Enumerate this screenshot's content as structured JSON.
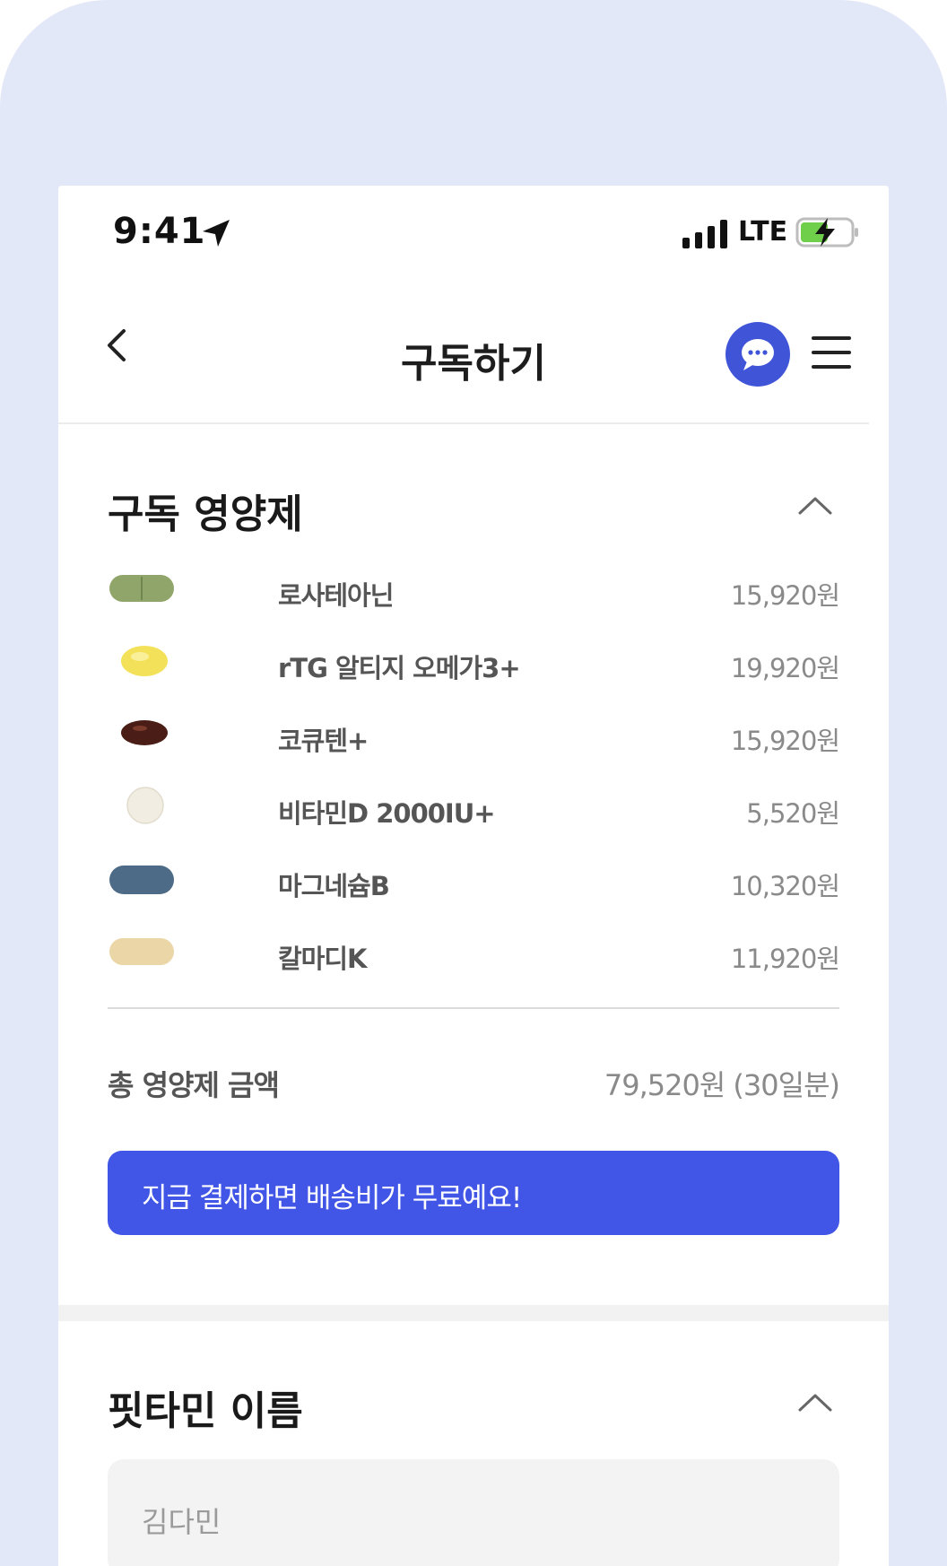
{
  "status_bar": {
    "time": "9:41",
    "network": "LTE"
  },
  "header": {
    "title": "구독하기",
    "chat_icon": "chat-bubble-icon",
    "menu_icon": "hamburger-menu-icon"
  },
  "subscription": {
    "title": "구독 영양제",
    "items": [
      {
        "name": "로사테아닌",
        "price": "15,920원",
        "pill_color": "#8fa56a"
      },
      {
        "name": "rTG 알티지 오메가3+",
        "price": "19,920원",
        "pill_color": "#f4e15a"
      },
      {
        "name": "코큐텐+",
        "price": "15,920원",
        "pill_color": "#4a1e16"
      },
      {
        "name": "비타민D 2000IU+",
        "price": "5,520원",
        "pill_color": "#f1ede2"
      },
      {
        "name": "마그네슘B",
        "price": "10,320원",
        "pill_color": "#4d6a86"
      },
      {
        "name": "칼마디K",
        "price": "11,920원",
        "pill_color": "#ead6a6"
      }
    ],
    "total_label": "총 영양제 금액",
    "total_value": "79,520원 (30일분)",
    "promo_text": "지금 결제하면 배송비가 무료예요!"
  },
  "name_section": {
    "title": "핏타민 이름",
    "input_value": "김다민"
  },
  "colors": {
    "accent": "#4156e6",
    "background": "#e3e8f9"
  }
}
